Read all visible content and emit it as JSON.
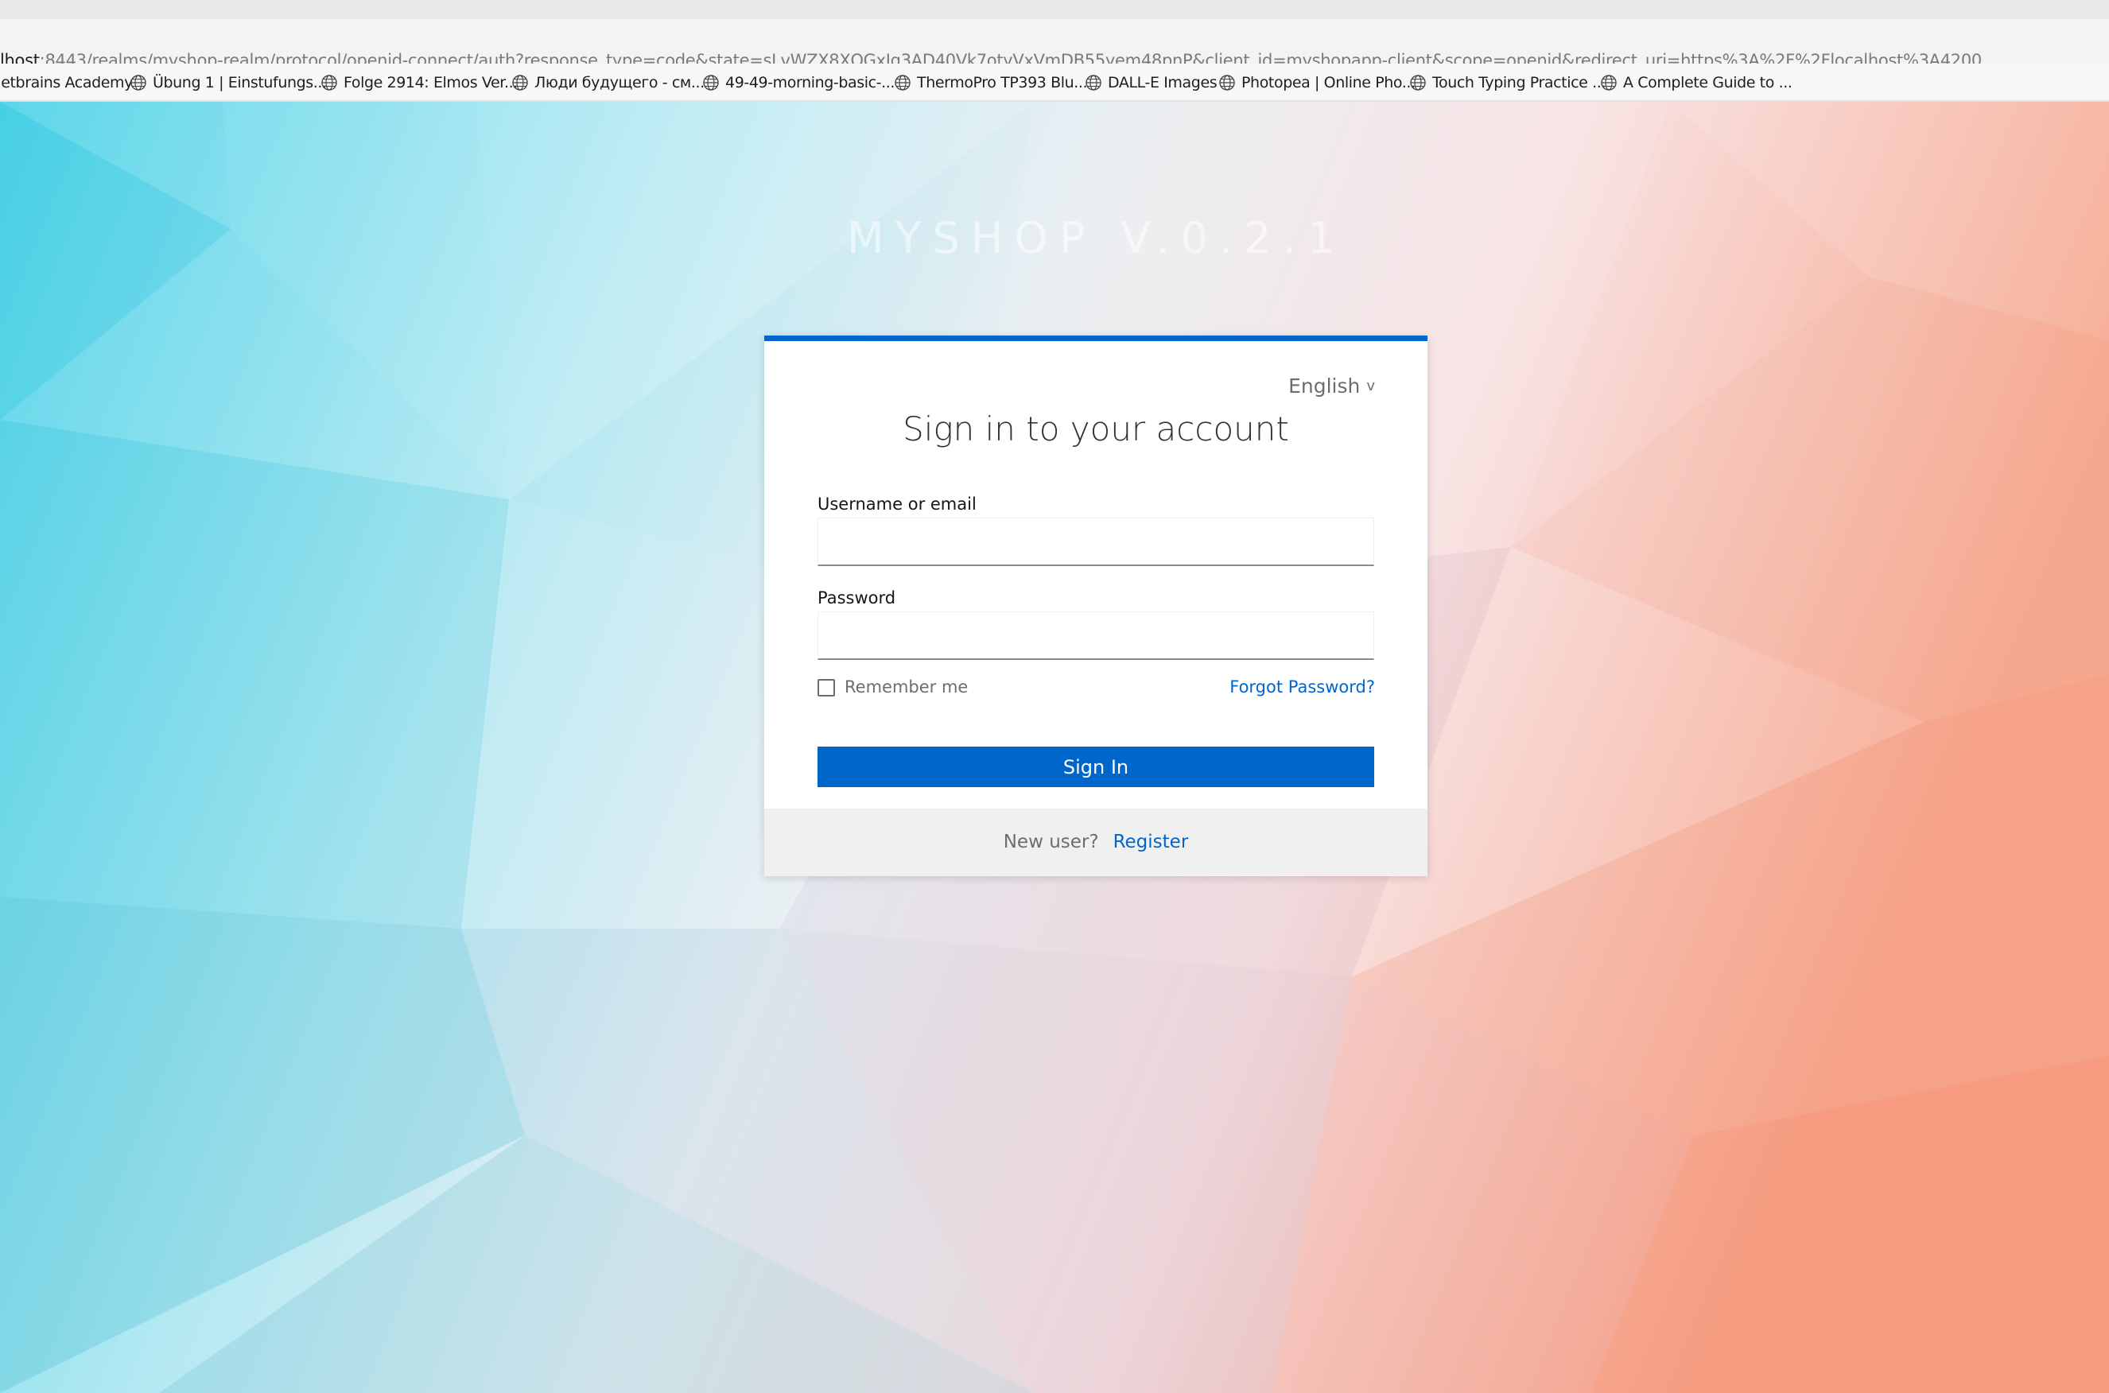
{
  "browser": {
    "url_host": "lhost",
    "url_rest": ":8443/realms/myshop-realm/protocol/openid-connect/auth?response_type=code&state=sLvWZX8XQGxIq3AD40Vk7otyVxVmDB55yem48pnP&client_id=myshopapp-client&scope=openid&redirect_uri=https%3A%2F%2Flocalhost%3A4200",
    "bookmarks": [
      {
        "label": "Jetbrains Academy",
        "icon": "none"
      },
      {
        "label": "Übung 1 | Einstufungs...",
        "icon": "globe-icon"
      },
      {
        "label": "Folge 2914: Elmos Ver...",
        "icon": "globe-icon"
      },
      {
        "label": "Люди будущего - см...",
        "icon": "globe-icon"
      },
      {
        "label": "49-49-morning-basic-...",
        "icon": "globe-icon"
      },
      {
        "label": "ThermoPro TP393 Blu...",
        "icon": "globe-icon"
      },
      {
        "label": "DALL-E Images",
        "icon": "globe-icon"
      },
      {
        "label": "Photopea | Online Pho...",
        "icon": "globe-icon"
      },
      {
        "label": "Touch Typing Practice ...",
        "icon": "globe-icon"
      },
      {
        "label": "A Complete Guide to ...",
        "icon": "globe-icon"
      }
    ]
  },
  "page": {
    "brand": "MYSHOP V.0.2.1",
    "language": "English",
    "title": "Sign in to your account",
    "username_label": "Username or email",
    "username_value": "",
    "password_label": "Password",
    "password_value": "",
    "remember_label": "Remember me",
    "remember_checked": false,
    "forgot_label": "Forgot Password?",
    "signin_label": "Sign In",
    "new_user_text": "New user?",
    "register_label": "Register"
  },
  "colors": {
    "accent": "#0066cc",
    "background_left": "#4fd3e8",
    "background_right": "#f7a58a"
  }
}
